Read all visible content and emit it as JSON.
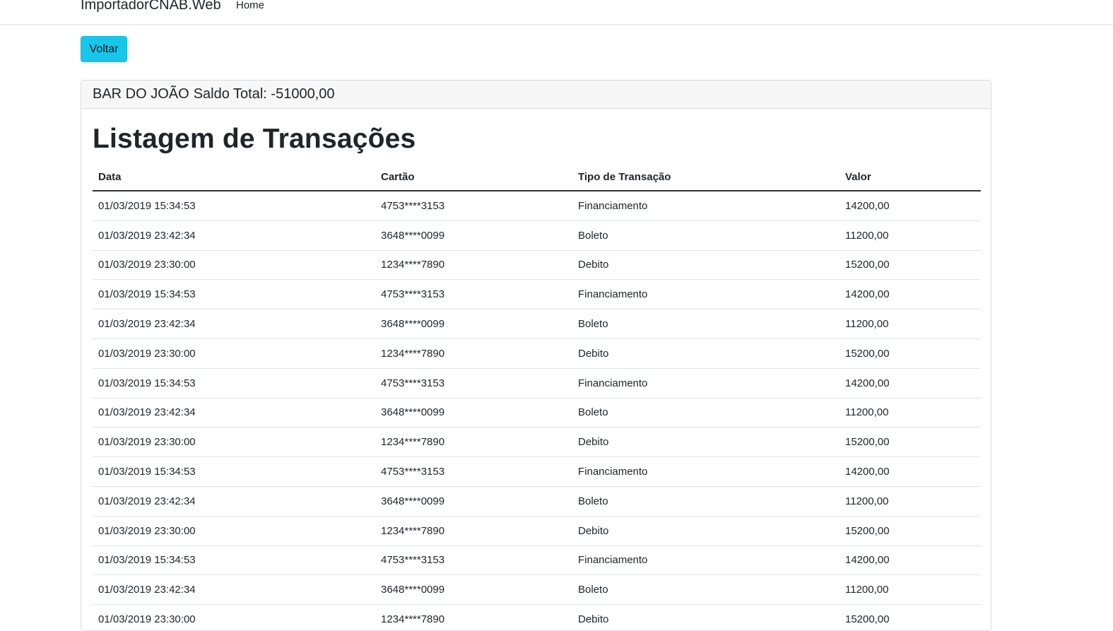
{
  "navbar": {
    "brand": "ImportadorCNAB.Web",
    "home": "Home"
  },
  "actions": {
    "back_label": "Voltar"
  },
  "card": {
    "store_name": "BAR DO JOÃO",
    "balance_label": "Saldo Total: -51000,00"
  },
  "page": {
    "title": "Listagem de Transações"
  },
  "table": {
    "headers": [
      "Data",
      "Cartão",
      "Tipo de Transação",
      "Valor"
    ],
    "rows": [
      [
        "01/03/2019 15:34:53",
        "4753****3153",
        "Financiamento",
        "14200,00"
      ],
      [
        "01/03/2019 23:42:34",
        "3648****0099",
        "Boleto",
        "11200,00"
      ],
      [
        "01/03/2019 23:30:00",
        "1234****7890",
        "Debito",
        "15200,00"
      ],
      [
        "01/03/2019 15:34:53",
        "4753****3153",
        "Financiamento",
        "14200,00"
      ],
      [
        "01/03/2019 23:42:34",
        "3648****0099",
        "Boleto",
        "11200,00"
      ],
      [
        "01/03/2019 23:30:00",
        "1234****7890",
        "Debito",
        "15200,00"
      ],
      [
        "01/03/2019 15:34:53",
        "4753****3153",
        "Financiamento",
        "14200,00"
      ],
      [
        "01/03/2019 23:42:34",
        "3648****0099",
        "Boleto",
        "11200,00"
      ],
      [
        "01/03/2019 23:30:00",
        "1234****7890",
        "Debito",
        "15200,00"
      ],
      [
        "01/03/2019 15:34:53",
        "4753****3153",
        "Financiamento",
        "14200,00"
      ],
      [
        "01/03/2019 23:42:34",
        "3648****0099",
        "Boleto",
        "11200,00"
      ],
      [
        "01/03/2019 23:30:00",
        "1234****7890",
        "Debito",
        "15200,00"
      ],
      [
        "01/03/2019 15:34:53",
        "4753****3153",
        "Financiamento",
        "14200,00"
      ],
      [
        "01/03/2019 23:42:34",
        "3648****0099",
        "Boleto",
        "11200,00"
      ],
      [
        "01/03/2019 23:30:00",
        "1234****7890",
        "Debito",
        "15200,00"
      ]
    ]
  },
  "colors": {
    "button": "#17c7eb",
    "header_bg": "#f7f7f7"
  }
}
